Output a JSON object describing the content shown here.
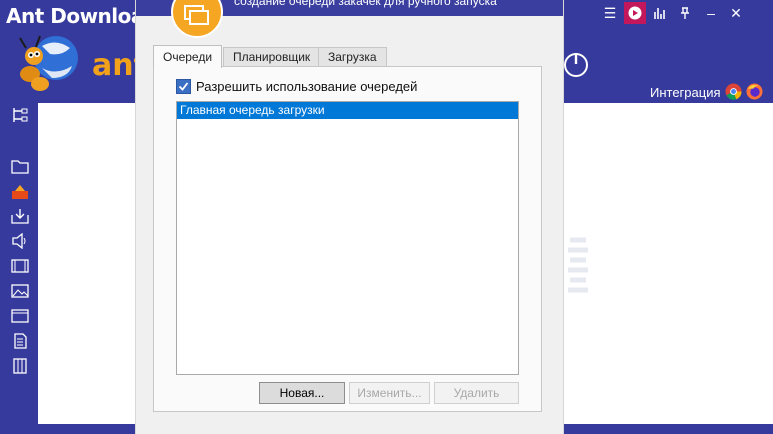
{
  "app": {
    "title": "Ant Download",
    "brand": "ant"
  },
  "window_controls": [
    {
      "name": "menu-icon",
      "glyph": "☰"
    },
    {
      "name": "play-icon",
      "glyph": "▶"
    },
    {
      "name": "equalizer-icon",
      "glyph": "ıl"
    },
    {
      "name": "pin-icon",
      "glyph": "⊥"
    },
    {
      "name": "minimize-icon",
      "glyph": "–"
    },
    {
      "name": "close-icon",
      "glyph": "✕"
    }
  ],
  "header": {
    "integration_label": "Интеграция"
  },
  "dialog": {
    "subtitle": "создание очереди закачек для ручного запуска",
    "tabs": [
      {
        "label": "Очереди",
        "active": true
      },
      {
        "label": "Планировщик",
        "active": false
      },
      {
        "label": "Загрузка",
        "active": false
      }
    ],
    "enable_queues": {
      "label": "Разрешить использование очередей",
      "checked": true
    },
    "queues": [
      {
        "label": "Главная очередь загрузки",
        "selected": true
      }
    ],
    "buttons": {
      "new": "Новая...",
      "edit": "Изменить...",
      "delete": "Удалить"
    }
  },
  "colors": {
    "accent": "#353a9c",
    "selection": "#0078d7",
    "dialog_icon": "#f5a623",
    "play_active": "#c2185b"
  }
}
